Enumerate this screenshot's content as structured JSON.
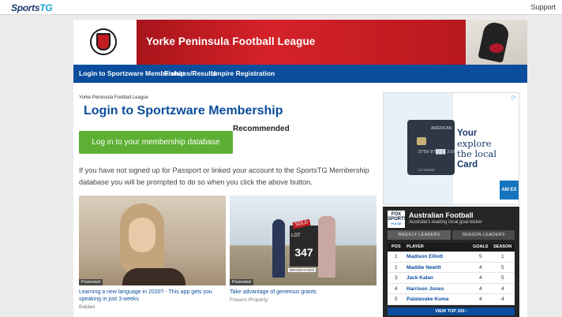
{
  "topbar": {
    "brand_a": "Sports",
    "brand_b": "TG",
    "support": "Support"
  },
  "banner": {
    "title": "Yorke Peninsula Football League"
  },
  "nav": {
    "items": [
      "Login to Sportzware Membership",
      "Fixtures/Results",
      "Umpire Registration"
    ]
  },
  "breadcrumb": "Yorke Peninsula Football League",
  "page_title": "Login to Sportzware Membership",
  "recommended": "Recommended",
  "login_button": "Log in to your membership database",
  "info_text": "If you have not signed up for Passport or linked your account to the SportsTG Membership database you will be prompted to do so when you click the above button.",
  "promos": [
    {
      "badge": "Promoted",
      "caption": "Learning a new language in 2020? - This app gets you speaking in just 3 weeks",
      "source": "Babbel"
    },
    {
      "badge": "Promoted",
      "caption": "Take advantage of generous grants",
      "source": "Frasers Property",
      "sign_sold": "SOLD",
      "sign_lot": "LOT",
      "sign_number": "347",
      "sign_brand": "BROOKHAVEN"
    }
  ],
  "ad": {
    "line1": "Your",
    "line2": "explore",
    "line3": "the local",
    "line4": "Card",
    "card_brand": "AMERICAN",
    "card_number": "3759 87███ 21007",
    "card_name": "C F FROST",
    "logo_text": "AM EX",
    "adchoice": "▷"
  },
  "widget": {
    "logo_top": "FOX SPORTS",
    "logo_bottom": "PULSE",
    "title": "Australian Football",
    "subtitle": "Australia's leading local goal kicker",
    "tabs": [
      "WEEKLY LEADERS",
      "SEASON LEADERS"
    ],
    "headers": [
      "POS",
      "PLAYER",
      "GOALS",
      "SEASON"
    ],
    "rows": [
      {
        "pos": "1",
        "player": "Madison Elliott",
        "goals": "5",
        "season": "1"
      },
      {
        "pos": "2",
        "player": "Maddie Newitt",
        "goals": "4",
        "season": "5"
      },
      {
        "pos": "3",
        "player": "Jack Kalan",
        "goals": "4",
        "season": "5"
      },
      {
        "pos": "4",
        "player": "Harrison Jones",
        "goals": "4",
        "season": "4"
      },
      {
        "pos": "5",
        "player": "Palatavake Kuma",
        "goals": "4",
        "season": "4"
      }
    ],
    "view_top": "VIEW TOP 100 ›"
  }
}
